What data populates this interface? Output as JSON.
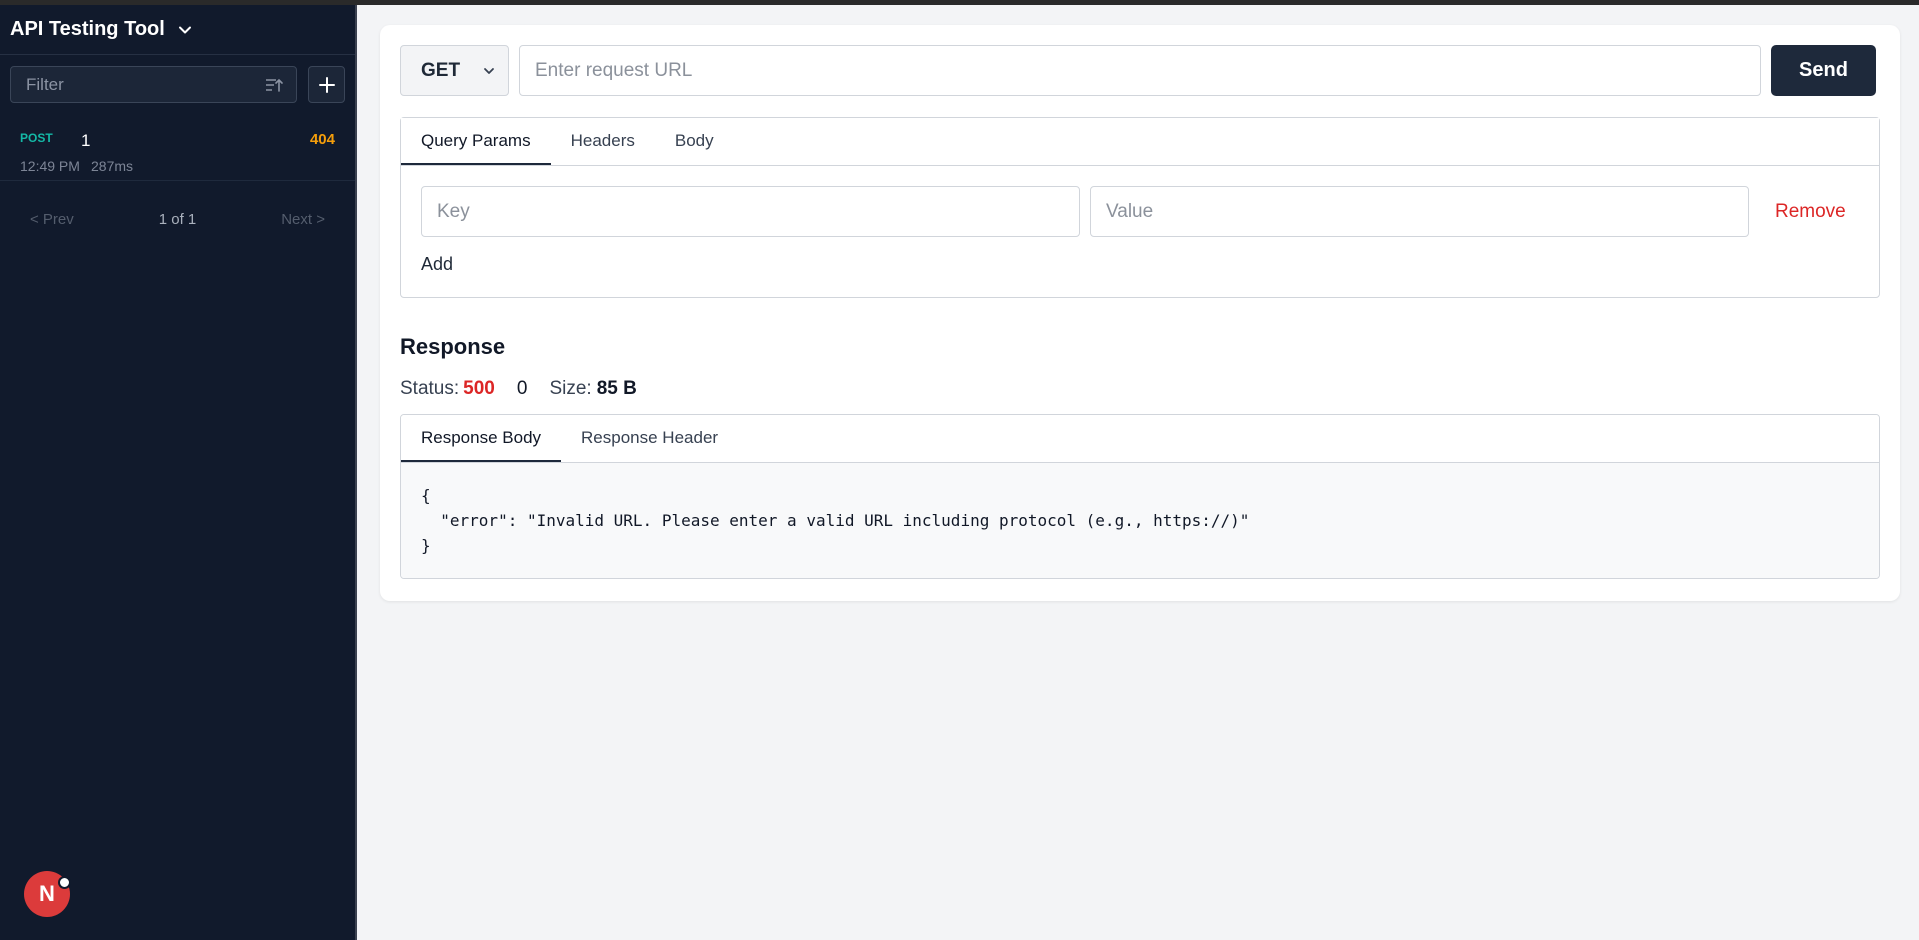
{
  "app": {
    "title": "API Testing Tool"
  },
  "sidebar": {
    "filter_placeholder": "Filter",
    "history": [
      {
        "method": "POST",
        "name": "1",
        "status": "404",
        "time": "12:49 PM",
        "duration": "287ms"
      }
    ],
    "pager": {
      "prev": "< Prev",
      "info": "1 of 1",
      "next": "Next >"
    },
    "avatar_letter": "N"
  },
  "request": {
    "method": "GET",
    "url_placeholder": "Enter request URL",
    "send_label": "Send",
    "tabs": [
      "Query Params",
      "Headers",
      "Body"
    ],
    "active_tab": "Query Params",
    "params": {
      "key_placeholder": "Key",
      "value_placeholder": "Value",
      "remove_label": "Remove",
      "add_label": "Add"
    }
  },
  "response": {
    "title": "Response",
    "status_label": "Status:",
    "status_code": "500",
    "time": "0",
    "size_label": "Size:",
    "size_value": "85 B",
    "tabs": [
      "Response Body",
      "Response Header"
    ],
    "active_tab": "Response Body",
    "body": "{\n  \"error\": \"Invalid URL. Please enter a valid URL including protocol (e.g., https://)\"\n}"
  },
  "colors": {
    "sidebar_bg": "#111a2c",
    "method_post": "#14b8a6",
    "status_404": "#f59e0b",
    "status_500": "#dc2626",
    "send_bg": "#1e293b",
    "avatar_bg": "#dc3b3b"
  }
}
